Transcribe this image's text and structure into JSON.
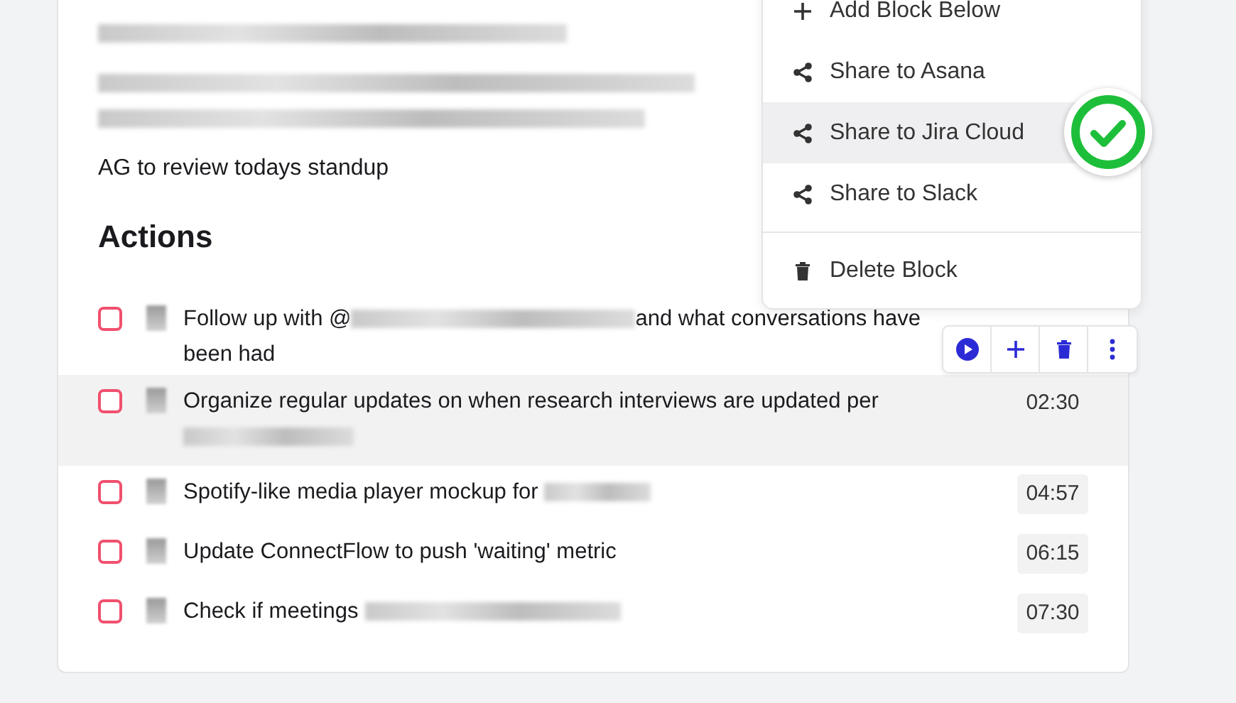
{
  "notes": [
    {
      "kind": "redacted"
    },
    {
      "kind": "redacted"
    },
    {
      "kind": "redacted"
    },
    {
      "kind": "text",
      "text": "AG to review todays standup"
    }
  ],
  "actions": {
    "heading": "Actions",
    "items": [
      {
        "checked": false,
        "highlighted": false,
        "segments": [
          {
            "kind": "text",
            "text": "Follow up with @"
          },
          {
            "kind": "redacted"
          },
          {
            "kind": "text",
            "text": "and what conversations have been had"
          }
        ]
      },
      {
        "checked": false,
        "highlighted": true,
        "time": "02:30",
        "segments": [
          {
            "kind": "text",
            "text": "Organize regular updates on when research interviews are updated per "
          },
          {
            "kind": "redacted"
          }
        ]
      },
      {
        "checked": false,
        "highlighted": false,
        "time": "04:57",
        "segments": [
          {
            "kind": "text",
            "text": "Spotify-like media player mockup for "
          },
          {
            "kind": "redacted"
          }
        ]
      },
      {
        "checked": false,
        "highlighted": false,
        "time": "06:15",
        "segments": [
          {
            "kind": "text",
            "text": "Update ConnectFlow to push 'waiting' metric"
          }
        ]
      },
      {
        "checked": false,
        "highlighted": false,
        "time": "07:30",
        "segments": [
          {
            "kind": "text",
            "text": "Check if meetings "
          },
          {
            "kind": "redacted"
          }
        ]
      }
    ]
  },
  "block_menu": {
    "items": [
      {
        "kind": "add",
        "label": "Add Block Below",
        "selected": false
      },
      {
        "kind": "share",
        "label": "Share to Asana",
        "selected": false
      },
      {
        "kind": "share",
        "label": "Share to Jira Cloud",
        "selected": true
      },
      {
        "kind": "share",
        "label": "Share to Slack",
        "selected": false
      },
      {
        "kind": "delete",
        "label": "Delete Block",
        "selected": false
      }
    ]
  }
}
